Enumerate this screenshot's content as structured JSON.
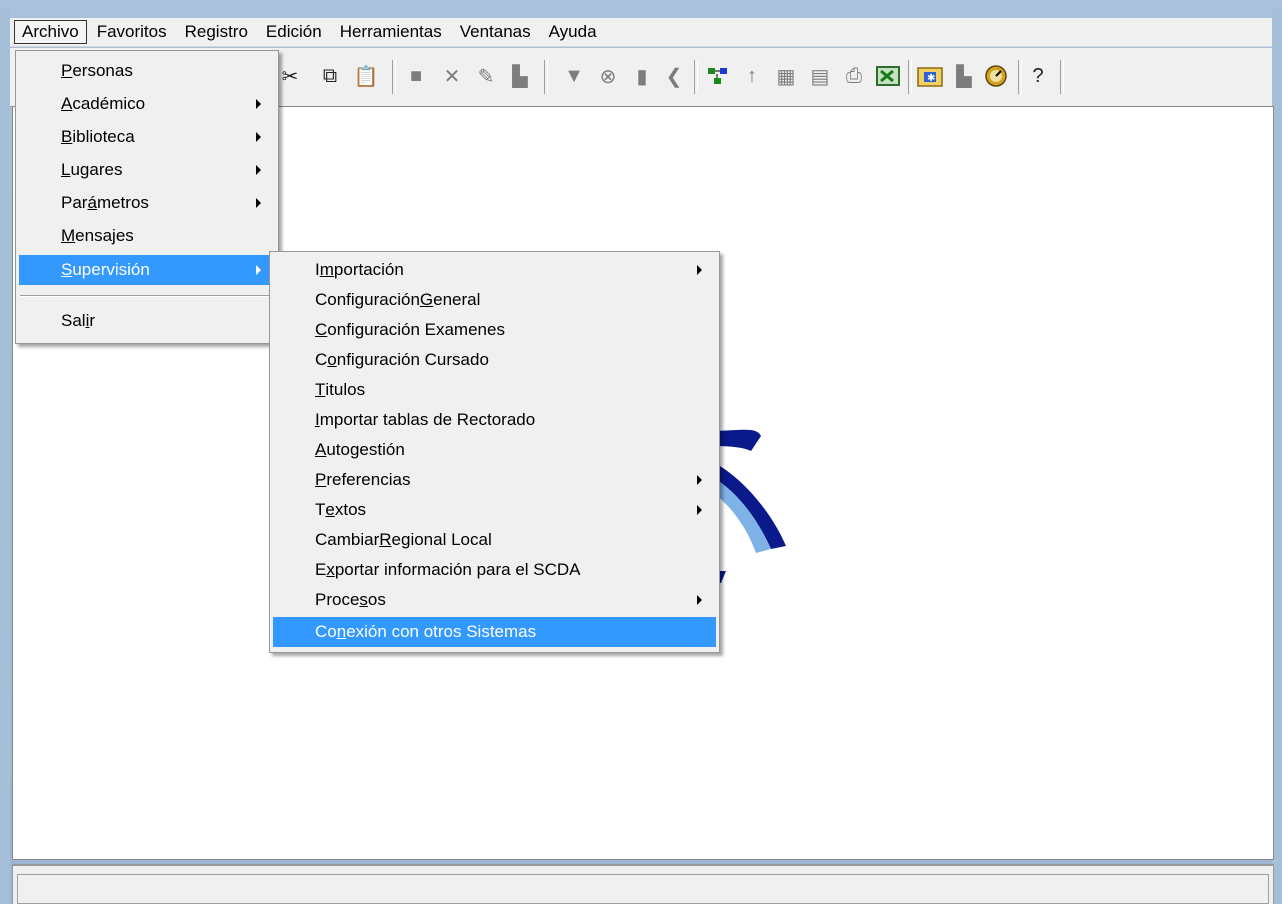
{
  "menubar": {
    "items": [
      {
        "label": "Archivo"
      },
      {
        "label": "Favoritos"
      },
      {
        "label": "Registro"
      },
      {
        "label": "Edición"
      },
      {
        "label": "Herramientas"
      },
      {
        "label": "Ventanas"
      },
      {
        "label": "Ayuda"
      }
    ]
  },
  "archivo_menu": {
    "items": [
      {
        "pre": "",
        "acc": "P",
        "post": "ersonas"
      },
      {
        "pre": "",
        "acc": "A",
        "post": "cadémico"
      },
      {
        "pre": "",
        "acc": "B",
        "post": "iblioteca"
      },
      {
        "pre": "",
        "acc": "L",
        "post": "ugares"
      },
      {
        "pre": "Par",
        "acc": "á",
        "post": "metros"
      },
      {
        "pre": "",
        "acc": "M",
        "post": "ensajes"
      },
      {
        "pre": "",
        "acc": "S",
        "post": "upervisión"
      },
      {
        "pre": "Sal",
        "acc": "i",
        "post": "r"
      }
    ]
  },
  "supervision_menu": {
    "items": [
      {
        "pre": "I",
        "acc": "m",
        "post": "portación"
      },
      {
        "pre": "Configuración ",
        "acc": "G",
        "post": "eneral"
      },
      {
        "pre": "",
        "acc": "C",
        "post": "onfiguración Examenes"
      },
      {
        "pre": "C",
        "acc": "o",
        "post": "nfiguración Cursado"
      },
      {
        "pre": "",
        "acc": "T",
        "post": "itulos"
      },
      {
        "pre": "",
        "acc": "I",
        "post": "mportar tablas de Rectorado"
      },
      {
        "pre": "",
        "acc": "A",
        "post": "utogestión"
      },
      {
        "pre": "",
        "acc": "P",
        "post": "referencias"
      },
      {
        "pre": "T",
        "acc": "e",
        "post": "xtos"
      },
      {
        "pre": "Cambiar ",
        "acc": "R",
        "post": "egional Local"
      },
      {
        "pre": "E",
        "acc": "x",
        "post": "portar información para el SCDA"
      },
      {
        "pre": "Proce",
        "acc": "s",
        "post": "os"
      },
      {
        "pre": "Co",
        "acc": "n",
        "post": "exión con otros Sistemas"
      }
    ]
  },
  "toolbar": {
    "icons": [
      "cut-icon",
      "copy-icon",
      "paste-icon",
      "new-record-icon",
      "delete-icon",
      "edit-record-icon",
      "save-record-icon",
      "filter-icon",
      "cancel-filter-icon",
      "document-icon",
      "undo-icon",
      "tree-icon",
      "up-arrow-icon",
      "grid-icon",
      "table-icon",
      "print-icon",
      "export-excel-icon",
      "folder-icon",
      "add-icon",
      "clock-icon",
      "help-icon"
    ]
  },
  "colors": {
    "highlight": "#3399ff",
    "menu_bg": "#f0f0f0",
    "frame": "#a9c1dc",
    "logo_dark": "#0a1a8a",
    "logo_light": "#7fb2e6"
  }
}
